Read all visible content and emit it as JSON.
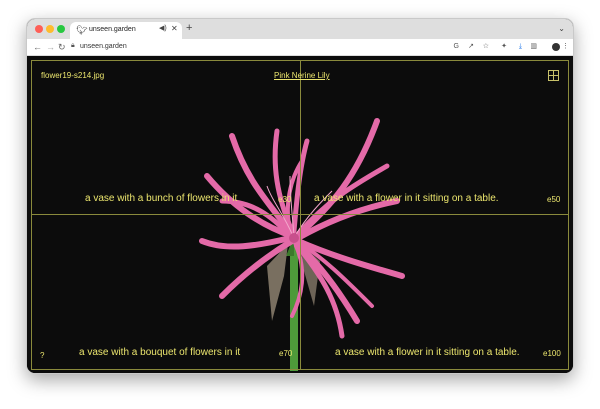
{
  "browser": {
    "tab_title": "unseen.garden",
    "new_tab_glyph": "+",
    "url": "unseen.garden"
  },
  "page": {
    "filename": "flower19-s214.jpg",
    "title_link": "Pink Nerine Lily",
    "help_label": "?",
    "captions": [
      {
        "text": "a vase with a bunch of flowers in it",
        "code": "e30"
      },
      {
        "text": "a vase with a flower in it sitting on a table.",
        "code": "e50"
      },
      {
        "text": "a vase with a bouquet of flowers in it",
        "code": "e70"
      },
      {
        "text": "a vase with a flower in it sitting on a table.",
        "code": "e100"
      }
    ]
  },
  "colors": {
    "caption_yellow": "#ece66e",
    "grid_line": "#8a8a3c",
    "background": "#0c0c0c",
    "flower_pink": "#e46aa8",
    "stem_green": "#4e9a3a"
  },
  "icons": {
    "favicon": "bird-icon",
    "layout_toggle": "grid-icon"
  }
}
